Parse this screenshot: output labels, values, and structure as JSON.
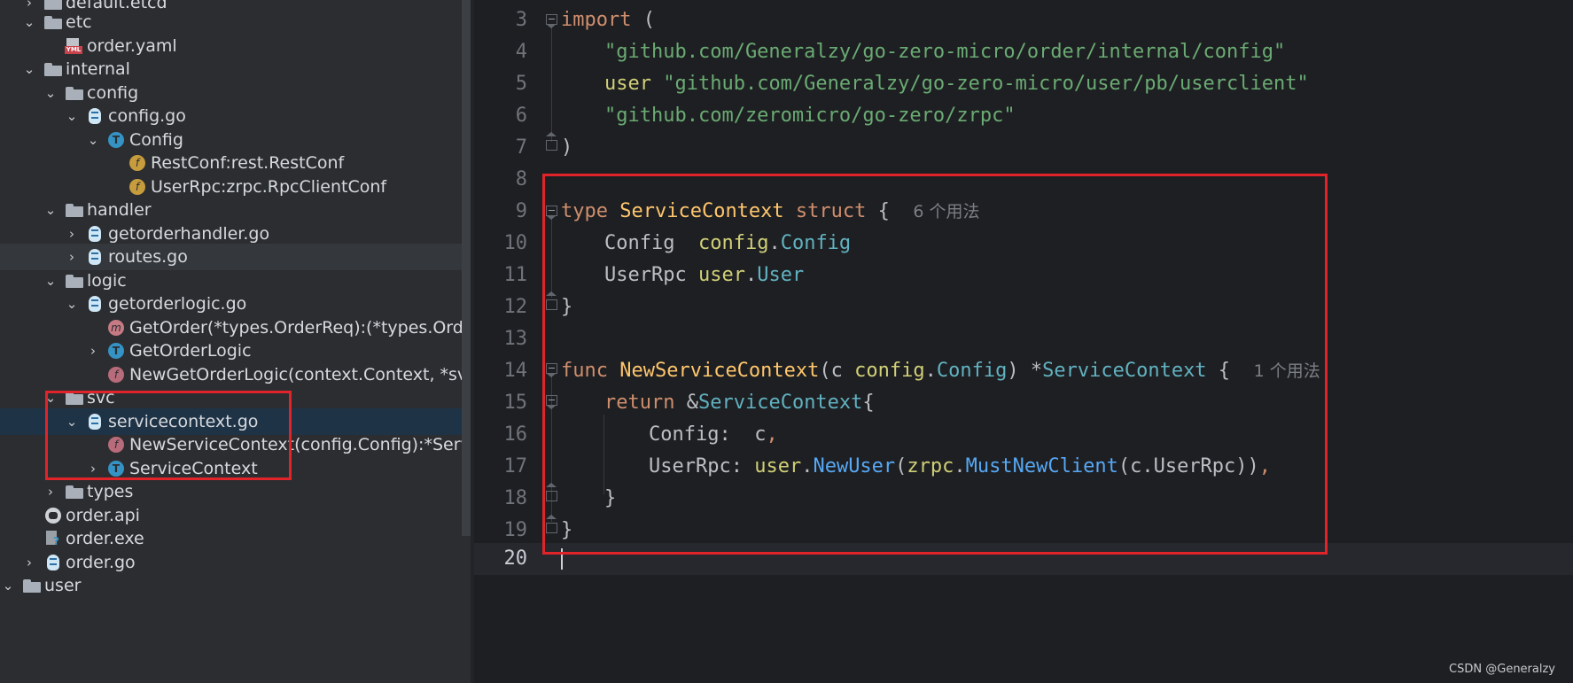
{
  "tree": {
    "rows": [
      {
        "label": "default.etcd"
      },
      {
        "label": "etc"
      },
      {
        "label": "order.yaml",
        "icon_text": "YML"
      },
      {
        "label": "internal"
      },
      {
        "label": "config"
      },
      {
        "label": "config.go"
      },
      {
        "label": "Config",
        "badge": "T"
      },
      {
        "label": "RestConf:rest.RestConf",
        "badge": "f"
      },
      {
        "label": "UserRpc:zrpc.RpcClientConf",
        "badge": "f"
      },
      {
        "label": "handler"
      },
      {
        "label": "getorderhandler.go"
      },
      {
        "label": "routes.go"
      },
      {
        "label": "logic"
      },
      {
        "label": "getorderlogic.go"
      },
      {
        "label": "GetOrder(*types.OrderReq):(*types.OrderReply, err",
        "badge": "m"
      },
      {
        "label": "GetOrderLogic",
        "badge": "T"
      },
      {
        "label": "NewGetOrderLogic(context.Context, *svc.ServiceCo",
        "badge": "f"
      },
      {
        "label": "svc"
      },
      {
        "label": "servicecontext.go"
      },
      {
        "label": "NewServiceContext(config.Config):*ServiceContext",
        "badge": "f"
      },
      {
        "label": "ServiceContext",
        "badge": "T"
      },
      {
        "label": "types"
      },
      {
        "label": "order.api"
      },
      {
        "label": "order.exe",
        "icon_text": "?"
      },
      {
        "label": "order.go"
      },
      {
        "label": "user"
      }
    ]
  },
  "editor": {
    "line_numbers": [
      "3",
      "4",
      "5",
      "6",
      "7",
      "8",
      "9",
      "10",
      "11",
      "12",
      "13",
      "14",
      "15",
      "16",
      "17",
      "18",
      "19",
      "20"
    ],
    "l3": {
      "kw": "import",
      "rest": " ("
    },
    "l4": {
      "str": "\"github.com/Generalzy/go-zero-micro/order/internal/config\""
    },
    "l5": {
      "alias": "user",
      "str": "\"github.com/Generalzy/go-zero-micro/user/pb/userclient\""
    },
    "l6": {
      "str": "\"github.com/zeromicro/go-zero/zrpc\""
    },
    "l7": {
      "text": ")"
    },
    "l9": {
      "kw1": "type",
      "name": "ServiceContext",
      "kw2": "struct",
      "brace": " {",
      "hint": "6 个用法"
    },
    "l10": {
      "field": "Config  ",
      "pkg": "config",
      "dot": ".",
      "type": "Config"
    },
    "l11": {
      "field": "UserRpc ",
      "pkg": "user",
      "dot": ".",
      "type": "User"
    },
    "l12": {
      "text": "}"
    },
    "l14": {
      "kw": "func",
      "name": "NewServiceContext",
      "p1": "(c ",
      "pkg": "config",
      "dot": ".",
      "type": "Config",
      "p2": ") *",
      "ret": "ServiceContext",
      "brace": " {",
      "hint": "1 个用法"
    },
    "l15": {
      "kw": "return",
      "amp": " &",
      "type": "ServiceContext",
      "brace": "{"
    },
    "l16": {
      "field": "Config:  c",
      "comma": ","
    },
    "l17": {
      "field": "UserRpc: ",
      "pkg": "user",
      "dot1": ".",
      "fn1": "NewUser",
      "p1": "(",
      "pkg2": "zrpc",
      "dot2": ".",
      "fn2": "MustNewClient",
      "p2": "(c.UserRpc))",
      "comma": ","
    },
    "l18": {
      "text": "}"
    },
    "l19": {
      "text": "}"
    }
  },
  "watermark": "CSDN @Generalzy",
  "colors": {
    "highlight_box": "#e0242a",
    "keyword": "#cf8e6d",
    "string": "#6aab73",
    "package": "#d0d077",
    "type": "#56a8f5"
  }
}
